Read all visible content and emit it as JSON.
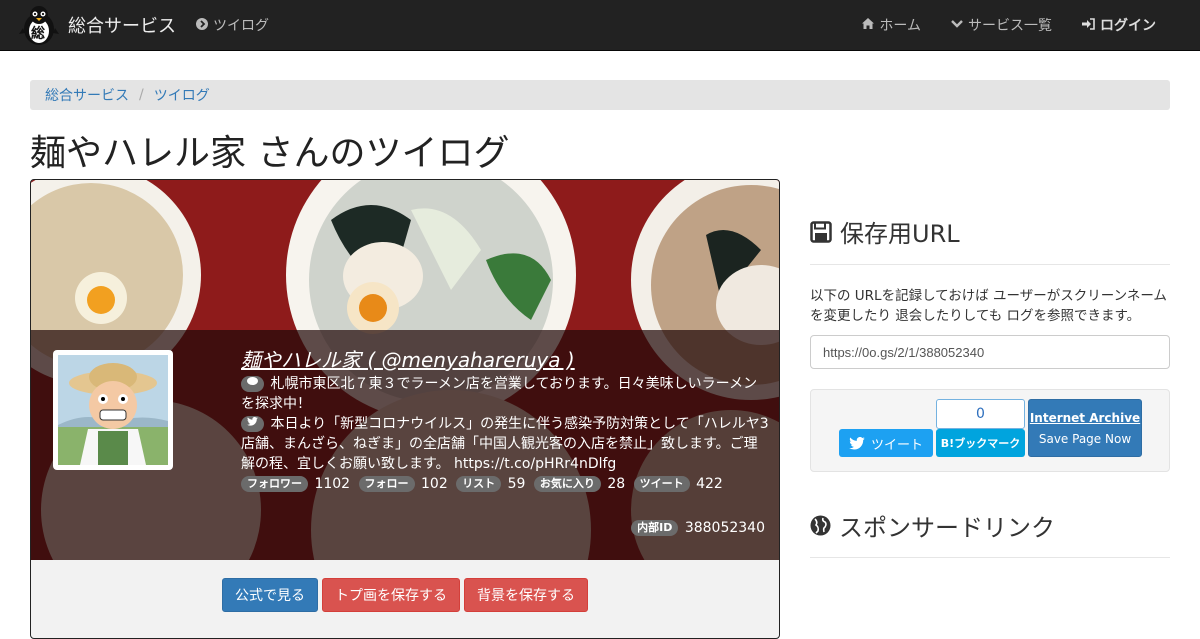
{
  "navbar": {
    "brand": "総合サービス",
    "logo_char": "総",
    "tsuilog": "ツイログ",
    "home": "ホーム",
    "services": "サービス一覧",
    "login": "ログイン"
  },
  "breadcrumb": {
    "items": [
      "総合サービス",
      "ツイログ"
    ],
    "separator": "/"
  },
  "page_title": "麺やハレル家 さんのツイログ",
  "profile": {
    "name": "麺やハレル家 ( @menyahareruya )",
    "bio": "札幌市東区北７東３でラーメン店を営業しております。日々美味しいラーメンを探求中！",
    "latest": "本日より「新型コロナウイルス」の発生に伴う感染予防対策として「ハレルヤ3店舗、まんざら、ねぎま」の全店舗「中国人観光客の入店を禁止」致します。ご理解の程、宜しくお願い致します。 https://t.co/pHRr4nDlfg",
    "stats": [
      {
        "label": "フォロワー",
        "value": "1102"
      },
      {
        "label": "フォロー",
        "value": "102"
      },
      {
        "label": "リスト",
        "value": "59"
      },
      {
        "label": "お気に入り",
        "value": "28"
      },
      {
        "label": "ツイート",
        "value": "422"
      }
    ],
    "internal_id_label": "内部ID",
    "internal_id": "388052340"
  },
  "buttons": {
    "official": "公式で見る",
    "save_header": "トプ画を保存する",
    "save_bg": "背景を保存する"
  },
  "sidebar": {
    "save_url_title": "保存用URL",
    "save_url_desc": "以下の URLを記録しておけば ユーザーがスクリーンネームを変更したり 退会したりしても ログを参照できます。",
    "url": "https://0o.gs/2/1/388052340",
    "tweet": "ツイート",
    "hatena_count": "0",
    "hatena_label": "B!ブックマーク",
    "ia_title": "Internet Archive",
    "ia_sub": "Save Page Now",
    "sponsored_title": "スポンサードリンク"
  },
  "colors": {
    "navbar": "#222222",
    "link": "#337ab7",
    "primary": "#337ab7",
    "danger": "#d9534f",
    "banner": "#8b1a1a"
  }
}
